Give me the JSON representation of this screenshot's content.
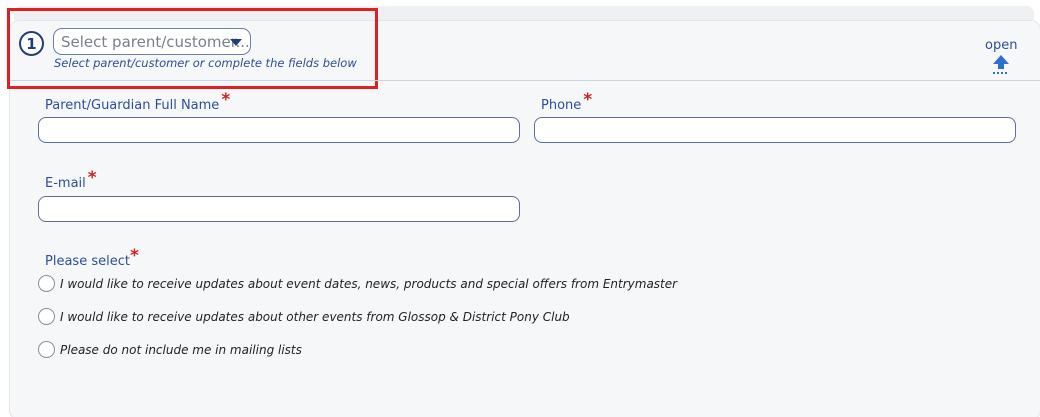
{
  "step": {
    "number": "1",
    "select_placeholder": "Select parent/customer...",
    "hint": "Select parent/customer or complete the fields below"
  },
  "toggle": {
    "label": "open",
    "icon": "upload-arrow-icon"
  },
  "fields": {
    "parent_name": {
      "label": "Parent/Guardian Full Name",
      "required": "*",
      "value": ""
    },
    "phone": {
      "label": "Phone",
      "required": "*",
      "value": ""
    },
    "email": {
      "label": "E-mail",
      "required": "*",
      "value": ""
    }
  },
  "preferences": {
    "label": "Please select",
    "required": "*",
    "options": [
      "I would like to receive updates about event dates, news, products and special offers from Entrymaster",
      "I would like to receive updates about other events from Glossop & District Pony Club",
      "Please do not include me in mailing lists"
    ]
  },
  "colors": {
    "accent": "#1f3f7a",
    "label": "#2d4f93",
    "required": "#d32020",
    "highlight": "#e02020",
    "panel_bg": "#f6f7f9"
  }
}
